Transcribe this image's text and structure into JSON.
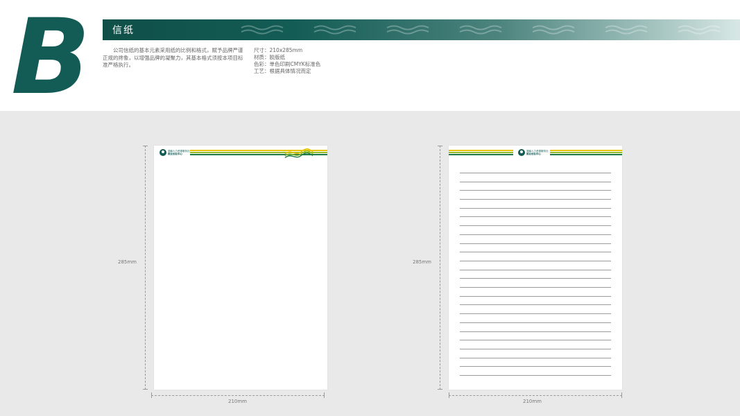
{
  "section_letter": "B",
  "banner": {
    "title": "信纸"
  },
  "description": "公司信纸的基本元素采用纸的比例和格式，赋予品牌严谨正规的搀象，以增强品牌的凝聚力，其基本格式须按本项目标准严格执行。",
  "specs": [
    "尺寸：210x285mm",
    "材质：胶版纸",
    "色彩：单色印刷CMYK标准色",
    "工艺：根据具体情况而定"
  ],
  "sheets": [
    {
      "height_label": "285mm",
      "width_label": "210mm",
      "ruled": false
    },
    {
      "height_label": "285mm",
      "width_label": "210mm",
      "ruled": true,
      "ruled_line_count": 24
    }
  ],
  "logo": {
    "line1": "湖南人力资源服务社",
    "line2": "就业创业中心"
  },
  "colors": {
    "brand_green": "#135c55",
    "stripe_yellow": "#e6c200",
    "stripe_lime": "#8dbb2a",
    "stripe_green": "#1d7a45",
    "canvas_gray": "#e9e9e9"
  }
}
